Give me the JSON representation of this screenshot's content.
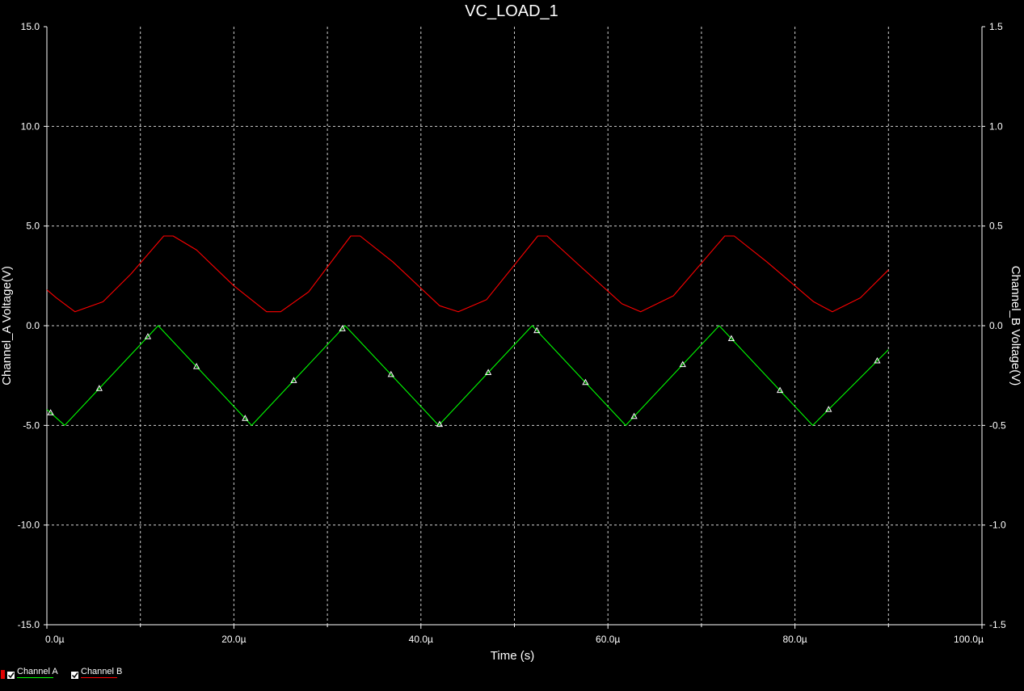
{
  "chart_data": {
    "type": "line",
    "title": "VC_LOAD_1",
    "xlabel": "Time (s)",
    "ylabel_left": "Channel_A Voltage(V)",
    "ylabel_right": "Channel_B Voltage(V)",
    "xlim": [
      0,
      100
    ],
    "ylim_left": [
      -15,
      15
    ],
    "ylim_right": [
      -1.5,
      1.5
    ],
    "x_ticks": [
      "0.0µ",
      "20.0µ",
      "40.0µ",
      "60.0µ",
      "80.0µ",
      "100.0µ"
    ],
    "y_ticks_left": [
      "15.0",
      "10.0",
      "5.0",
      "0.0",
      "-5.0",
      "-10.0",
      "-15.0"
    ],
    "y_ticks_right": [
      "1.5",
      "1.0",
      "0.5",
      "0.0",
      "-0.5",
      "-1.0",
      "-1.5"
    ],
    "grid": true,
    "legend_position": "bottom-left",
    "series": [
      {
        "name": "Channel A",
        "axis": "left",
        "color": "#00ff00",
        "x": [
          0,
          1.9,
          11.9,
          21.9,
          31.9,
          41.9,
          51.9,
          61.9,
          71.9,
          81.9,
          90
        ],
        "y": [
          -4.2,
          -5.0,
          0.0,
          -5.0,
          0.0,
          -5.0,
          0.0,
          -5.0,
          0.0,
          -5.0,
          -1.2
        ],
        "marker_x": [
          0.4,
          5.6,
          10.8,
          16.0,
          21.2,
          26.4,
          31.6,
          36.8,
          42.0,
          47.2,
          52.4,
          57.6,
          62.8,
          68.0,
          73.2,
          78.4,
          83.6,
          88.8
        ]
      },
      {
        "name": "Channel B",
        "axis": "left",
        "color": "#ff0000",
        "x": [
          0,
          1.0,
          3.0,
          6.0,
          9.0,
          12.5,
          13.5,
          16.0,
          20.0,
          23.5,
          25.0,
          28.0,
          32.5,
          33.5,
          37.0,
          42.0,
          44.0,
          47.0,
          52.5,
          53.5,
          57.0,
          61.5,
          63.5,
          67.0,
          72.5,
          73.5,
          77.0,
          82.0,
          84.0,
          87.0,
          90.0
        ],
        "y": [
          1.8,
          1.4,
          0.7,
          1.2,
          2.6,
          4.5,
          4.5,
          3.8,
          2.0,
          0.7,
          0.7,
          1.7,
          4.5,
          4.5,
          3.2,
          1.0,
          0.7,
          1.3,
          4.5,
          4.5,
          3.0,
          1.1,
          0.7,
          1.5,
          4.5,
          4.5,
          3.2,
          1.2,
          0.7,
          1.4,
          2.8
        ]
      }
    ]
  }
}
